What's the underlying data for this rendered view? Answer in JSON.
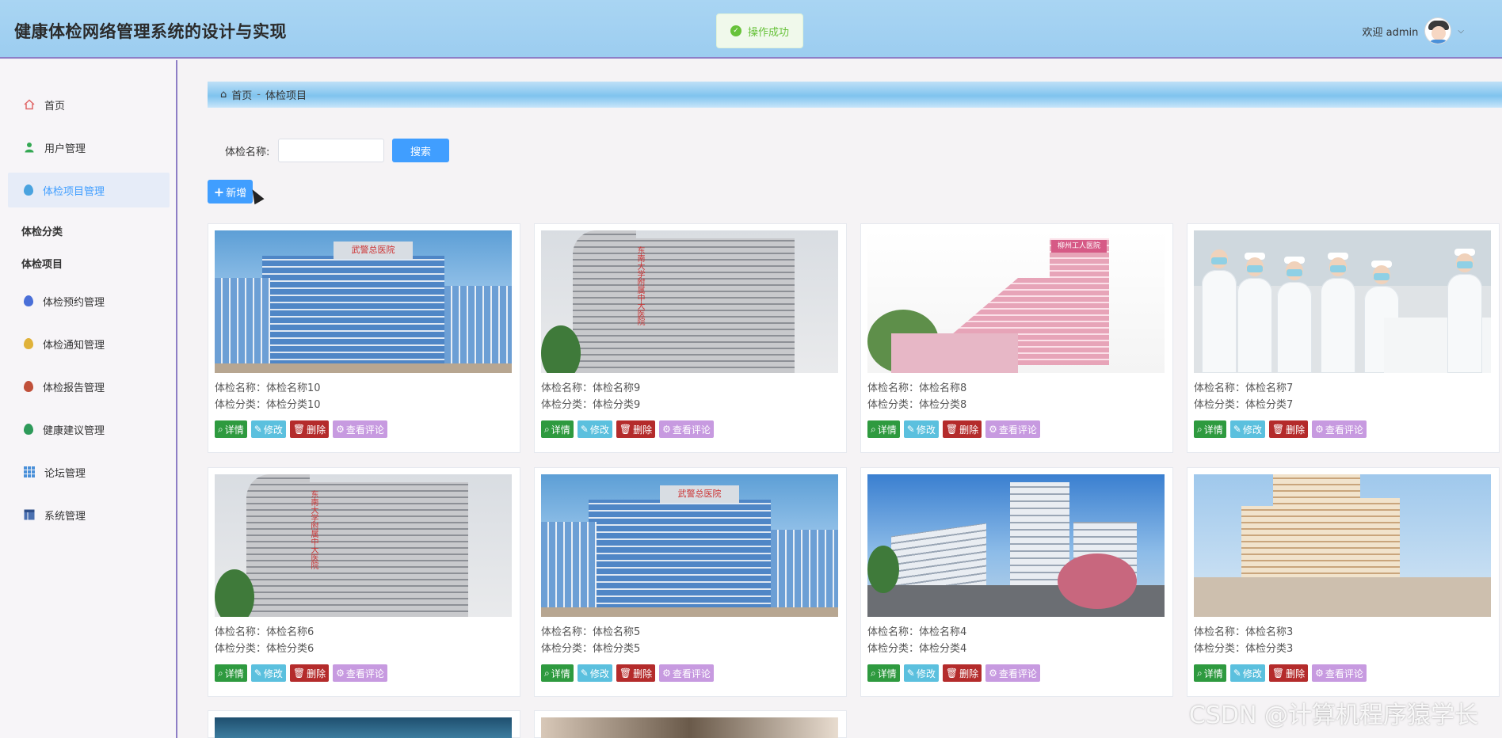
{
  "header": {
    "app_title": "健康体检网络管理系统的设计与实现",
    "toast": "操作成功",
    "welcome": "欢迎 admin"
  },
  "sidebar": {
    "items": [
      {
        "label": "首页",
        "icon": "home-icon",
        "color": "#e06666"
      },
      {
        "label": "用户管理",
        "icon": "user-icon",
        "color": "#34a853"
      },
      {
        "label": "体检项目管理",
        "icon": "drop-icon",
        "color": "#4aa3df"
      },
      {
        "label": "体检预约管理",
        "icon": "drop-icon",
        "color": "#4a6fd8"
      },
      {
        "label": "体检通知管理",
        "icon": "drop-icon",
        "color": "#e0b23a"
      },
      {
        "label": "体检报告管理",
        "icon": "drop-icon",
        "color": "#c0503a"
      },
      {
        "label": "健康建议管理",
        "icon": "drop-icon",
        "color": "#2e9a5a"
      },
      {
        "label": "论坛管理",
        "icon": "grid-icon",
        "color": "#4a90d9"
      },
      {
        "label": "系统管理",
        "icon": "table-icon",
        "color": "#4a6fb0"
      }
    ],
    "sub_items": [
      "体检分类",
      "体检项目"
    ],
    "active_index": 2
  },
  "breadcrumb": {
    "home": "首页",
    "sep": "-",
    "current": "体检项目"
  },
  "search": {
    "label": "体检名称:",
    "value": "",
    "button": "搜索"
  },
  "toolbar": {
    "add_label": "新增"
  },
  "card_labels": {
    "name_prefix": "体检名称：",
    "category_prefix": "体检分类：",
    "detail": "详情",
    "edit": "修改",
    "delete": "删除",
    "comments": "查看评论"
  },
  "cards": [
    {
      "name": "体检名称10",
      "category": "体检分类10",
      "image": "blue-glass-hospital"
    },
    {
      "name": "体检名称9",
      "category": "体检分类9",
      "image": "grey-tower-hospital"
    },
    {
      "name": "体检名称8",
      "category": "体检分类8",
      "image": "pink-hospital"
    },
    {
      "name": "体检名称7",
      "category": "体检分类7",
      "image": "nurses-ward"
    },
    {
      "name": "体检名称6",
      "category": "体检分类6",
      "image": "grey-tower-hospital"
    },
    {
      "name": "体检名称5",
      "category": "体检分类5",
      "image": "blue-glass-hospital"
    },
    {
      "name": "体检名称4",
      "category": "体检分类4",
      "image": "white-hospital-campus"
    },
    {
      "name": "体检名称3",
      "category": "体检分类3",
      "image": "tan-tower-hospital"
    }
  ],
  "watermark": "CSDN @计算机程序猿学长"
}
